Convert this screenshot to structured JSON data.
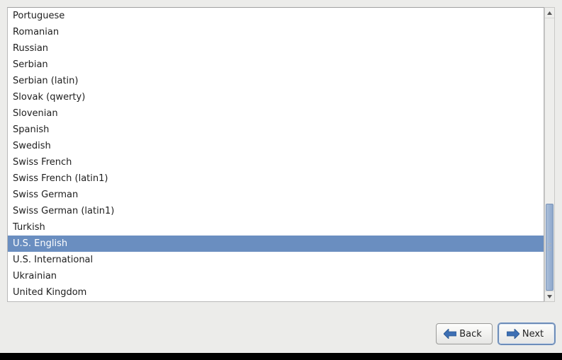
{
  "list": {
    "items": [
      {
        "label": "Portuguese",
        "selected": false
      },
      {
        "label": "Romanian",
        "selected": false
      },
      {
        "label": "Russian",
        "selected": false
      },
      {
        "label": "Serbian",
        "selected": false
      },
      {
        "label": "Serbian (latin)",
        "selected": false
      },
      {
        "label": "Slovak (qwerty)",
        "selected": false
      },
      {
        "label": "Slovenian",
        "selected": false
      },
      {
        "label": "Spanish",
        "selected": false
      },
      {
        "label": "Swedish",
        "selected": false
      },
      {
        "label": "Swiss French",
        "selected": false
      },
      {
        "label": "Swiss French (latin1)",
        "selected": false
      },
      {
        "label": "Swiss German",
        "selected": false
      },
      {
        "label": "Swiss German (latin1)",
        "selected": false
      },
      {
        "label": "Turkish",
        "selected": false
      },
      {
        "label": "U.S. English",
        "selected": true
      },
      {
        "label": "U.S. International",
        "selected": false
      },
      {
        "label": "Ukrainian",
        "selected": false
      },
      {
        "label": "United Kingdom",
        "selected": false
      }
    ]
  },
  "buttons": {
    "back": "Back",
    "next": "Next"
  },
  "colors": {
    "selection": "#6a8ec0",
    "arrow": "#3767a8"
  }
}
